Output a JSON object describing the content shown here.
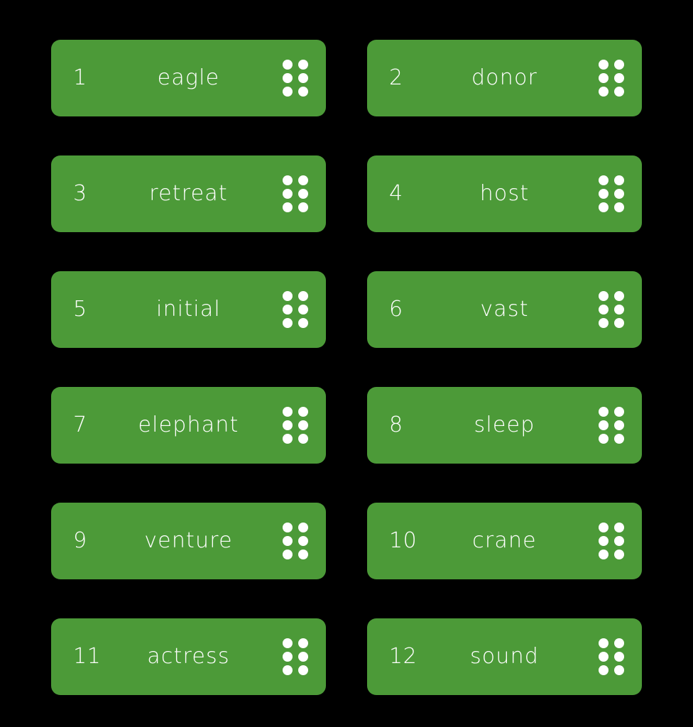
{
  "page": {
    "background_color": "#000000",
    "card_color": "#4C9A38",
    "text_color": "#FFFFFF",
    "columns": 2,
    "rows": 6
  },
  "handle": {
    "icon": "drag-handle-dots-icon",
    "dot_count": 6
  },
  "cards": [
    {
      "index": "1",
      "word": "eagle"
    },
    {
      "index": "2",
      "word": "donor"
    },
    {
      "index": "3",
      "word": "retreat"
    },
    {
      "index": "4",
      "word": "host"
    },
    {
      "index": "5",
      "word": "initial"
    },
    {
      "index": "6",
      "word": "vast"
    },
    {
      "index": "7",
      "word": "elephant"
    },
    {
      "index": "8",
      "word": "sleep"
    },
    {
      "index": "9",
      "word": "venture"
    },
    {
      "index": "10",
      "word": "crane"
    },
    {
      "index": "11",
      "word": "actress"
    },
    {
      "index": "12",
      "word": "sound"
    }
  ]
}
